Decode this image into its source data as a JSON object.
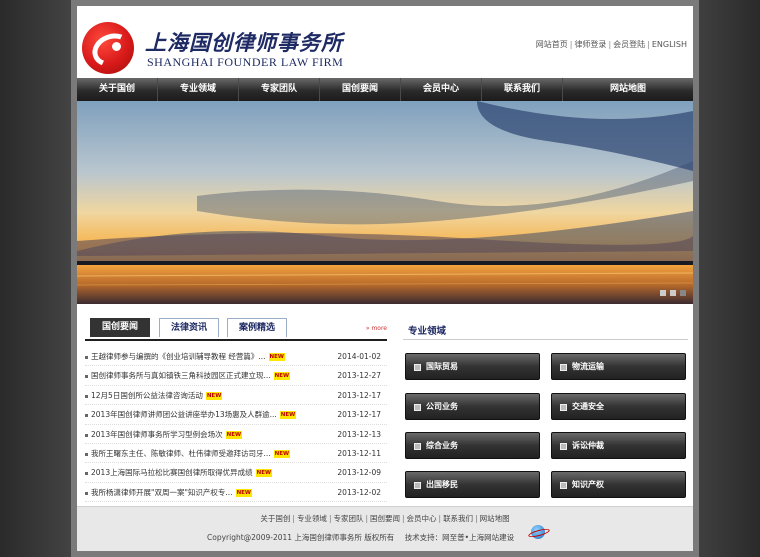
{
  "brand": {
    "name_cn": "上海国创律师事务所",
    "name_en": "SHANGHAI FOUNDER LAW FIRM"
  },
  "top_links": [
    "网站首页",
    "律师登录",
    "会员登陆",
    "ENGLISH"
  ],
  "nav": [
    "关于国创",
    "专业领域",
    "专家团队",
    "国创要闻",
    "会员中心",
    "联系我们",
    "网站地图"
  ],
  "news": {
    "tabs": [
      "国创要闻",
      "法律资讯",
      "案例精选"
    ],
    "more_label": "» more",
    "new_badge": "NEW",
    "items": [
      {
        "title": "王越律师参与编撰的《创业培训辅导教程 经营篇》...",
        "date": "2014-01-02"
      },
      {
        "title": "国创律师事务所与真如镇铁三角科技园区正式建立现...",
        "date": "2013-12-27"
      },
      {
        "title": "12月5日国创所公益法律咨询活动",
        "date": "2013-12-17"
      },
      {
        "title": "2013年国创律师讲师团公益讲座举办13场惠及人群逾...",
        "date": "2013-12-17"
      },
      {
        "title": "2013年国创律师事务所学习型例会场次",
        "date": "2013-12-13"
      },
      {
        "title": "我所王曙东主任、陈敏律师、杜伟律师受邀拜访司牙...",
        "date": "2013-12-11"
      },
      {
        "title": "2013上海国际马拉松比赛国创律所取得优异成绩",
        "date": "2013-12-09"
      },
      {
        "title": "我所杨潇律师开展\"双周一案\"知识产权专...",
        "date": "2013-12-02"
      }
    ]
  },
  "practice_areas": {
    "title": "专业领域",
    "items": [
      "国际贸易",
      "物流运输",
      "公司业务",
      "交通安全",
      "综合业务",
      "诉讼仲裁",
      "出国移民",
      "知识产权"
    ]
  },
  "footer": {
    "links": [
      "关于国创",
      "专业领域",
      "专家团队",
      "国创要闻",
      "会员中心",
      "联系我们",
      "网站地图"
    ],
    "copyright": "Copyright@2009-2011 上海国创律师事务所 版权所有",
    "support": "技术支持：网至普•上海网站建设"
  },
  "banner": {
    "slide_count": 3
  }
}
